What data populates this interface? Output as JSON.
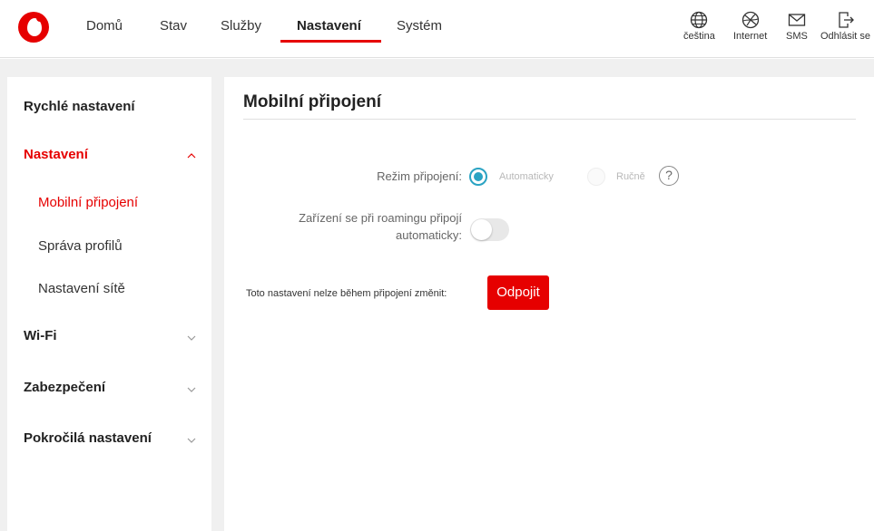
{
  "header": {
    "nav": [
      {
        "label": "Domů"
      },
      {
        "label": "Stav"
      },
      {
        "label": "Služby"
      },
      {
        "label": "Nastavení",
        "active": true
      },
      {
        "label": "Systém"
      }
    ],
    "tools": [
      {
        "label": "čeština",
        "icon": "globe-icon"
      },
      {
        "label": "Internet",
        "icon": "internet-icon"
      },
      {
        "label": "SMS",
        "icon": "envelope-icon"
      },
      {
        "label": "Odhlásit se",
        "icon": "logout-icon"
      }
    ]
  },
  "sidebar": {
    "quick": "Rychlé nastavení",
    "settings": "Nastavení",
    "sub": [
      "Mobilní připojení",
      "Správa profilů",
      "Nastavení sítě"
    ],
    "wifi": "Wi-Fi",
    "security": "Zabezpečení",
    "advanced": "Pokročilá nastavení"
  },
  "main": {
    "title": "Mobilní připojení",
    "mode_label": "Režim připojení:",
    "mode_auto": "Automaticky",
    "mode_manual": "Ručně",
    "mode_selected": "Automaticky",
    "help": "?",
    "roaming_label_1": "Zařízení se při roamingu připojí",
    "roaming_label_2": "automaticky:",
    "roaming_enabled": false,
    "note": "Toto nastavení nelze během připojení změnit:",
    "disconnect": "Odpojit"
  },
  "colors": {
    "brand_red": "#e60000",
    "radio_accent": "#2aa3c3"
  }
}
